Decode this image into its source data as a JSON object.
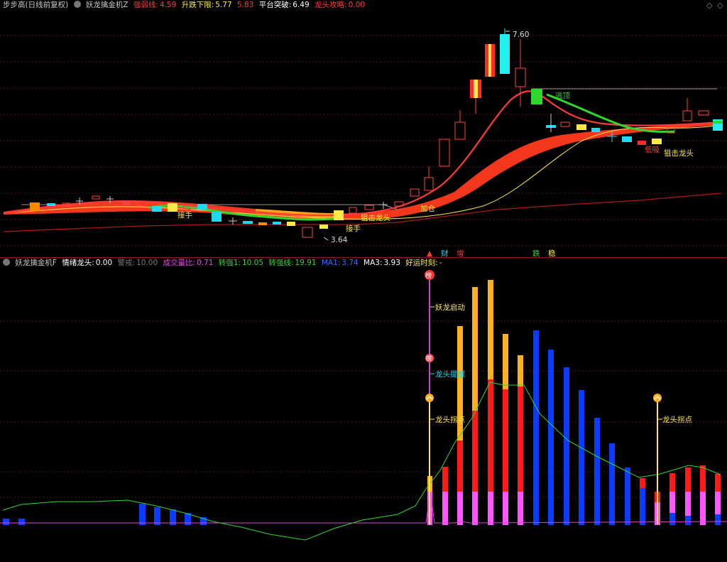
{
  "top_header": {
    "title": "步步高(日线前复权)",
    "indicator_name": "妖龙擒金机Z",
    "item1_label": "强弱线:",
    "item1_value": "4.59",
    "item2_label": "升跌下限:",
    "item2_value": "5.77",
    "item2_value2": "5.83",
    "item3_label": "平台突破:",
    "item3_value": "6.49",
    "item4_label": "龙头攻略:",
    "item4_value": "0.00",
    "colors": {
      "title": "#c8c8c8",
      "red": "#ff3b3b",
      "yellow": "#ffee44",
      "white": "#ffffff"
    }
  },
  "main_chart": {
    "price_high_label": "7.60",
    "price_low_label": "3.64",
    "annotations": {
      "a1": "接手",
      "a2": "接手",
      "a3": "狙击龙头",
      "a4": "加仓",
      "a5": "逃顶",
      "a6": "狙击龙头",
      "a7": "低吸"
    },
    "markers": {
      "m1": "财",
      "m2": "增",
      "m3": "跌",
      "m4": "稳"
    }
  },
  "sub_header": {
    "title": "妖龙擒金机F",
    "item1_label": "情绪龙头:",
    "item1_value": "0.00",
    "item2_label": "警戒:",
    "item2_value": "10.00",
    "item3_label": "成交量比:",
    "item3_value": "0.71",
    "item4_label": "转强1:",
    "item4_value": "10.05",
    "item5_label": "转强线:",
    "item5_value": "19.91",
    "item6_label": "MA1:",
    "item6_value": "3.74",
    "item7_label": "MA3:",
    "item7_value": "3.93",
    "item8_label": "好运时刻:",
    "item8_value": "-"
  },
  "sub_chart": {
    "badges": {
      "b1": "榜",
      "b2": "榜"
    },
    "labels": {
      "l1": "妖龙启动",
      "l2": "龙头提醒",
      "l3": "龙头拐点",
      "l4": "龙头拐点"
    }
  },
  "icons": [
    "settings-icon",
    "diamond-icon",
    "collapse-icon"
  ]
}
